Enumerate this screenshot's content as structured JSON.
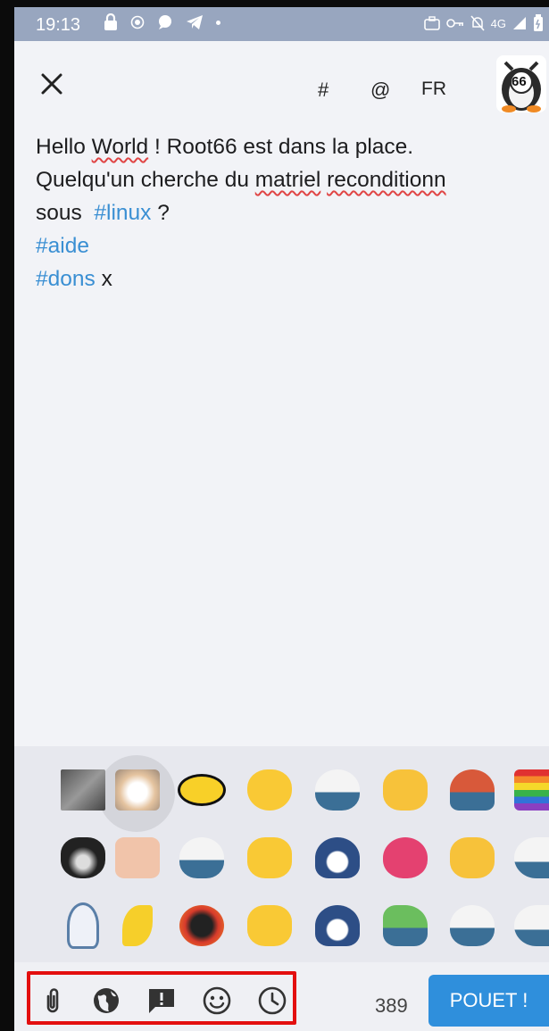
{
  "status_bar": {
    "time": "19:13",
    "network": "4G"
  },
  "header": {
    "hashtag_label": "#",
    "mention_label": "@",
    "language": "FR",
    "avatar_text": "66"
  },
  "composer": {
    "lines": [
      [
        {
          "t": "Hello "
        },
        {
          "t": "World",
          "style": "misspelled"
        },
        {
          "t": " ! Root66 est dans la place."
        }
      ],
      [
        {
          "t": "Quelqu'un cherche du "
        },
        {
          "t": "matriel",
          "style": "misspelled"
        },
        {
          "t": " "
        },
        {
          "t": "reconditionn",
          "style": "misspelled"
        }
      ],
      [
        {
          "t": "sous  "
        },
        {
          "t": "#linux",
          "style": "hashtag"
        },
        {
          "t": " ?"
        }
      ],
      [
        {
          "t": "#aide",
          "style": "hashtag"
        }
      ],
      [
        {
          "t": "#dons",
          "style": "hashtag"
        },
        {
          "t": " x"
        }
      ]
    ]
  },
  "emoji_picker": {
    "selected_index": 1,
    "items": [
      "cat-photo-grey",
      "cat-photo-white",
      "batman-logo",
      "blobcat-surprised",
      "blobshark",
      "blobcat-crying",
      "blobshark-ghost",
      "rainbow-flag-shark",
      "cat-photo-black",
      "cursed-cat-face",
      "blobshark-love",
      "blobcat-smug",
      "blobshark-hood",
      "heart-shark",
      "blobcat-tears",
      "blobshark-peek",
      "ghost-outline",
      "banana-arm",
      "blob-fire",
      "blobcat-grin",
      "blobshark-hood-2",
      "blobshark-green",
      "blobshark-happy",
      "blobshark-peek-2"
    ]
  },
  "bottom_bar": {
    "tools": [
      "paperclip-icon",
      "globe-icon",
      "alert-message-icon",
      "smiley-icon",
      "clock-icon"
    ],
    "char_count": "389",
    "submit_label": "POUET !"
  },
  "colors": {
    "accent": "#2f8fdc",
    "hashtag": "#3a8fd3",
    "highlight": "#e30f0f",
    "status_bar": "#98a6bf"
  }
}
